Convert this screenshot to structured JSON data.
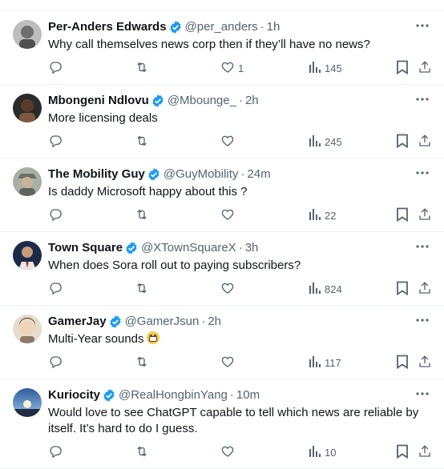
{
  "tweets": [
    {
      "name": "Per-Anders Edwards",
      "handle": "@per_anders",
      "time": "1h",
      "text": "Why call themselves news corp then if they’ll have no news?",
      "likes": "1",
      "views": "145",
      "avatar_color": "#9a9a9a"
    },
    {
      "name": "Mbongeni Ndlovu",
      "handle": "@Mbounge_",
      "time": "2h",
      "text": "More licensing deals",
      "likes": "",
      "views": "245",
      "avatar_color": "#3a2a22"
    },
    {
      "name": "The Mobility Guy",
      "handle": "@GuyMobility",
      "time": "24m",
      "text": "Is daddy Microsoft happy about this ?",
      "likes": "",
      "views": "22",
      "avatar_color": "#8b8f86"
    },
    {
      "name": "Town Square",
      "handle": "@XTownSquareX",
      "time": "3h",
      "text": "When does Sora roll out to paying subscribers?",
      "likes": "",
      "views": "824",
      "avatar_color": "#1c2a4a"
    },
    {
      "name": "GamerJay",
      "handle": "@GamerJsun",
      "time": "2h",
      "text": "Multi-Year sounds",
      "likes": "",
      "views": "117",
      "avatar_color": "#d9cdb8"
    },
    {
      "name": "Kuriocity",
      "handle": "@RealHongbinYang",
      "time": "10m",
      "text": "Would love to see ChatGPT capable to tell which news are reliable by itself. It’s hard to do I guess.",
      "likes": "",
      "views": "10",
      "avatar_color": "#3f6fa8"
    }
  ],
  "separator": "·",
  "colors": {
    "text": "#0f1419",
    "secondary": "#536471",
    "verified": "#1d9bf0",
    "divider": "#eff3f4"
  },
  "icons": [
    "verified-badge-icon",
    "more-icon",
    "reply-icon",
    "retweet-icon",
    "like-icon",
    "views-icon",
    "bookmark-icon",
    "share-icon"
  ]
}
